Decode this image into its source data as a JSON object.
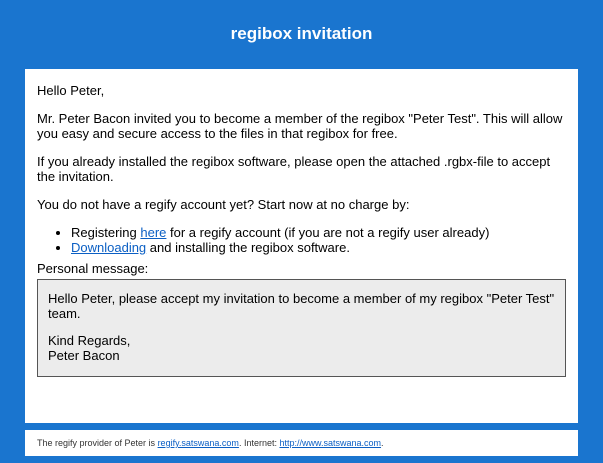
{
  "header": {
    "title": "regibox invitation"
  },
  "body": {
    "greeting": "Hello Peter,",
    "intro": "Mr. Peter Bacon invited you to become a member of the regibox \"Peter Test\". This will allow you easy and secure access to the files in that regibox for free.",
    "installed": "If you already installed the regibox software, please open the attached .rgbx-file to accept the invitation.",
    "no_account": "You do not have a regify account yet? Start now at no charge by:",
    "bullets": [
      {
        "prefix": "Registering ",
        "link": "here",
        "suffix": " for a regify account (if you are not a regify user already)"
      },
      {
        "prefix": "",
        "link": "Downloading",
        "suffix": " and installing the regibox software."
      }
    ]
  },
  "personal_message": {
    "label": "Personal message:",
    "text": "Hello Peter, please accept my invitation to become a member of my regibox \"Peter Test\" team.",
    "closing": "Kind Regards,",
    "signature": "Peter Bacon"
  },
  "footer": {
    "prefix": "The regify provider of Peter is ",
    "provider_link": "regify.satswana.com",
    "middle": ". Internet: ",
    "internet_link": "http://www.satswana.com",
    "suffix": "."
  },
  "colors": {
    "frame_blue": "#1a75cf",
    "link_blue": "#0b5fc4",
    "message_bg": "#ececec"
  }
}
